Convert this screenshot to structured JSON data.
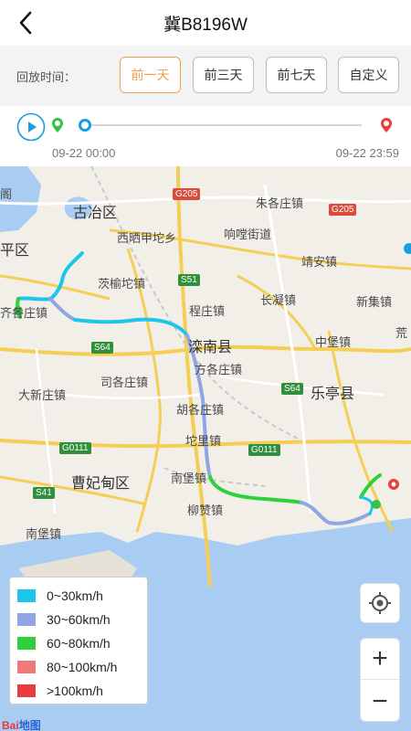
{
  "header": {
    "title": "冀B8196W"
  },
  "range": {
    "label": "回放时间：",
    "options": [
      "前一天",
      "前三天",
      "前七天",
      "自定义"
    ],
    "selected": "前一天",
    "accent_color": "#f0a24a"
  },
  "timeline": {
    "start_time": "09-22 00:00",
    "end_time": "09-22 23:59",
    "progress": 0
  },
  "map": {
    "places": [
      "古冶区",
      "西晒甲坨乡",
      "朱各庄镇",
      "响嘡街道",
      "平区",
      "靖安镇",
      "茨榆坨镇",
      "长凝镇",
      "新集镇",
      "齐各庄镇",
      "程庄镇",
      "滦南县",
      "中堡镇",
      "方各庄镇",
      "司各庄镇",
      "乐亭县",
      "大新庄镇",
      "胡各庄镇",
      "坨里镇",
      "曹妃甸区",
      "南堡镇",
      "柳赞镇",
      "南堡镇",
      "阁",
      "荒"
    ],
    "roads": [
      "G205",
      "G205",
      "S51",
      "S64",
      "S64",
      "G0111",
      "G0111",
      "S41"
    ],
    "logo_text": {
      "brand": "Bai",
      "suffix": "地图"
    }
  },
  "legend": [
    {
      "label": "0~30km/h",
      "color": "#1cc6ea"
    },
    {
      "label": "30~60km/h",
      "color": "#8fa6e4"
    },
    {
      "label": "60~80km/h",
      "color": "#2fd13a"
    },
    {
      "label": "80~100km/h",
      "color": "#f07a7a"
    },
    {
      "label": ">100km/h",
      "color": "#ea3c3c"
    }
  ],
  "controls": {
    "zoom_in": "+",
    "zoom_out": "−",
    "icons": [
      "back-icon",
      "play-icon",
      "start-pin-icon",
      "end-pin-icon",
      "locate-icon"
    ]
  }
}
